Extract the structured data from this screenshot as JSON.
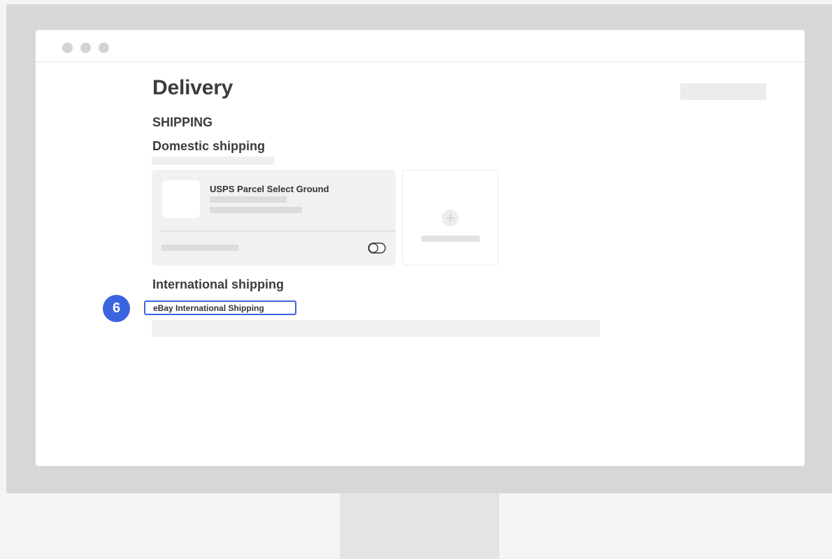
{
  "page": {
    "title": "Delivery",
    "section_label": "SHIPPING",
    "domestic_heading": "Domestic shipping",
    "international_heading": "International shipping"
  },
  "domestic_card": {
    "service_name": "USPS Parcel Select Ground"
  },
  "callout": {
    "step_number": "6",
    "highlighted_option": "eBay International Shipping",
    "accent_color": "#3a63e0"
  }
}
